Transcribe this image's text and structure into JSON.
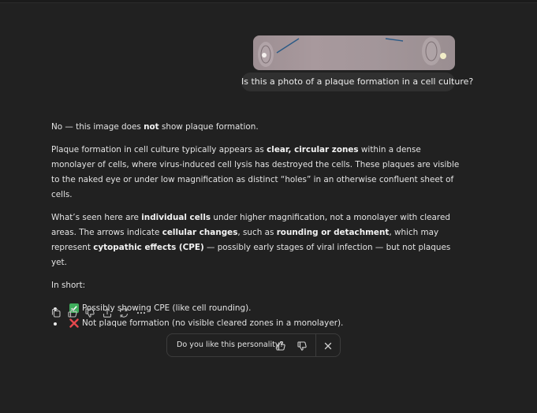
{
  "user_message": {
    "text": "Is this a photo of a plaque formation in a cell culture?"
  },
  "answer": {
    "p1": [
      "No — this image does ",
      "not",
      " show plaque formation."
    ],
    "p2": [
      "Plaque formation in cell culture typically appears as ",
      "clear, circular zones",
      " within a dense monolayer of cells, where virus-induced cell lysis has destroyed the cells. These plaques are visible to the naked eye or under low magnification as distinct “holes” in an otherwise confluent sheet of cells."
    ],
    "p3": [
      "What’s seen here are ",
      "individual cells",
      " under higher magnification, not a monolayer with cleared areas. The arrows indicate ",
      "cellular changes",
      ", such as ",
      "rounding or detachment",
      ", which may represent ",
      "cytopathic effects (CPE)",
      " — possibly early stages of viral infection — but not plaques yet."
    ],
    "p4": "In short:",
    "bullets": [
      {
        "icon": "check-mark-icon",
        "text": "Possibly showing CPE (like cell rounding)."
      },
      {
        "icon": "cross-mark-icon",
        "text": "Not plaque formation (no visible cleared zones in a monolayer)."
      }
    ]
  },
  "actions": [
    "copy-icon",
    "thumbs-up-icon",
    "thumbs-down-icon",
    "share-icon",
    "regenerate-icon",
    "more-icon"
  ],
  "feedback": {
    "question": "Do you like this personality?"
  },
  "colors": {
    "background": "#212121",
    "bubble": "#303030",
    "text": "#ececec",
    "check_green": "#3fae5c",
    "cross_red": "#e5484d"
  }
}
